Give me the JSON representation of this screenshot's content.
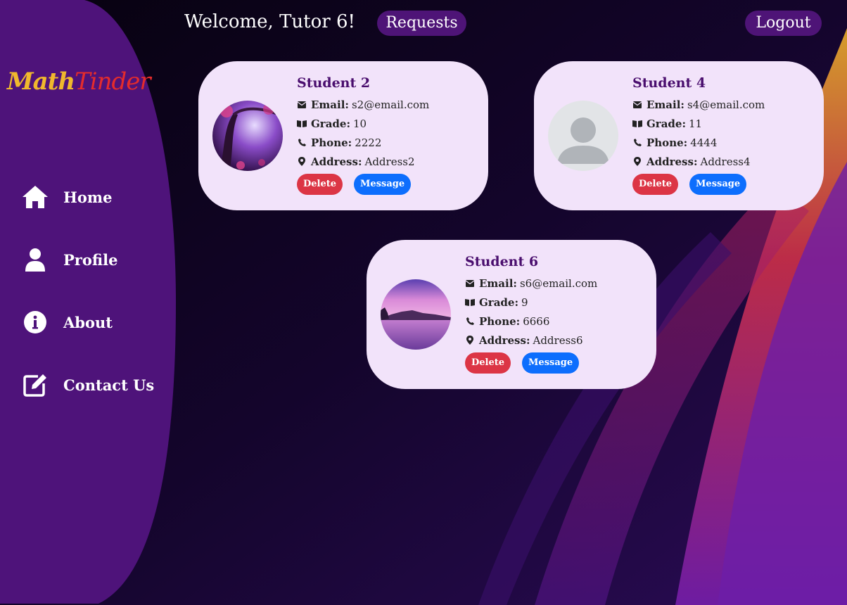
{
  "app": {
    "welcome": "Welcome, Tutor 6!",
    "requests_label": "Requests",
    "logout_label": "Logout",
    "logo_part1": "Math",
    "logo_part2": "Tinder"
  },
  "sidebar": {
    "items": [
      {
        "label": "Home",
        "icon": "home-icon"
      },
      {
        "label": "Profile",
        "icon": "user-icon"
      },
      {
        "label": "About",
        "icon": "info-icon"
      },
      {
        "label": "Contact Us",
        "icon": "edit-icon"
      }
    ]
  },
  "labels": {
    "email": "Email:",
    "grade": "Grade:",
    "phone": "Phone:",
    "address": "Address:",
    "delete": "Delete",
    "message": "Message"
  },
  "students": [
    {
      "name": "Student 2",
      "email": "s2@email.com",
      "grade": "10",
      "phone": "2222",
      "address": "Address2",
      "avatar": "fantasy-tree-photo"
    },
    {
      "name": "Student 4",
      "email": "s4@email.com",
      "grade": "11",
      "phone": "4444",
      "address": "Address4",
      "avatar": "default-avatar"
    },
    {
      "name": "Student 6",
      "email": "s6@email.com",
      "grade": "9",
      "phone": "6666",
      "address": "Address6",
      "avatar": "lake-sunset-photo"
    }
  ],
  "colors": {
    "sidebar": "#4e137a",
    "card": "#f2e3fa",
    "delete": "#dc3545",
    "message": "#0d6efd",
    "name": "#4a0e6e"
  }
}
